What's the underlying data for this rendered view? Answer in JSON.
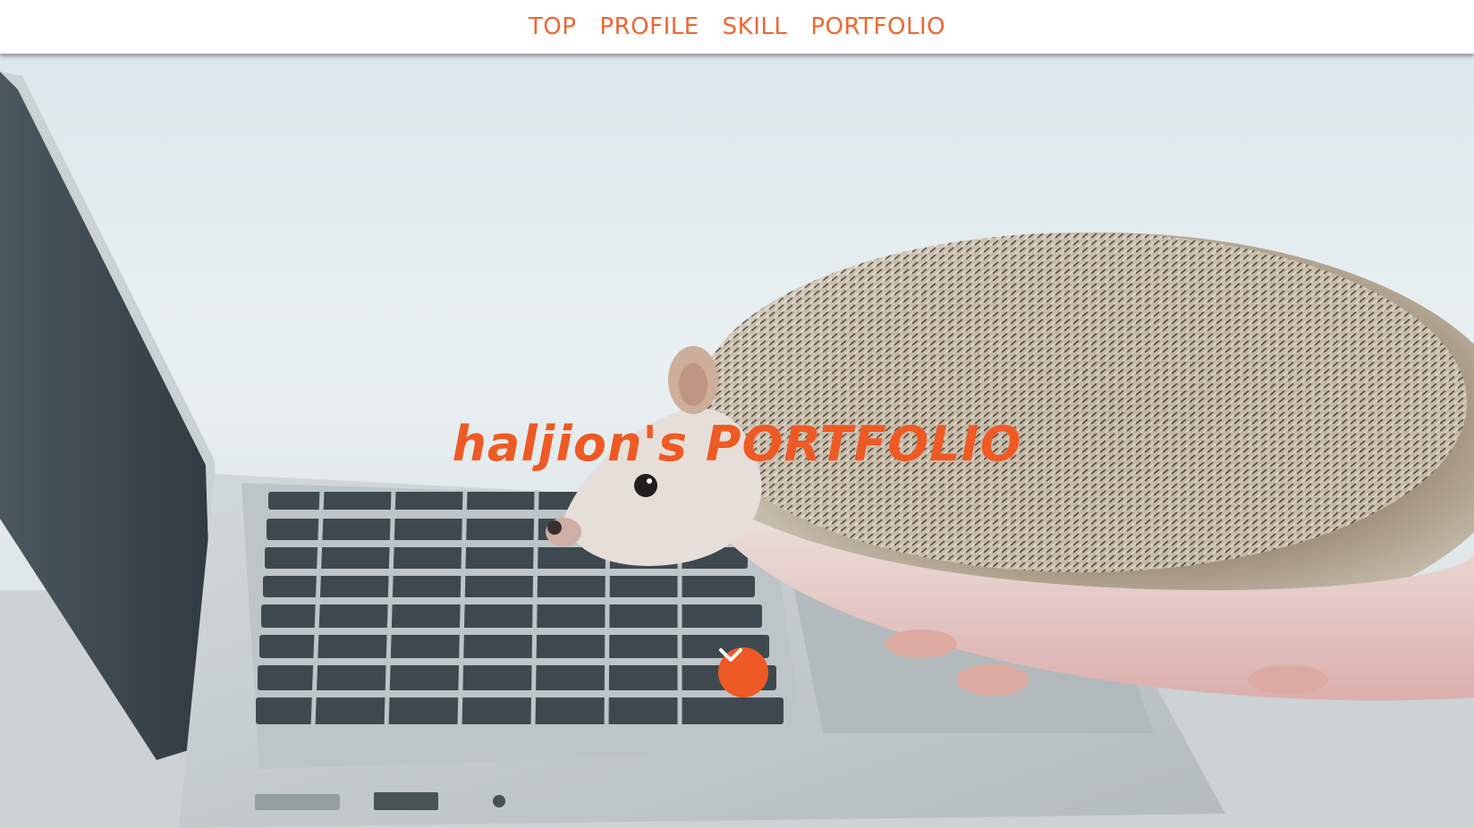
{
  "nav": {
    "items": [
      {
        "label": "TOP"
      },
      {
        "label": "PROFILE"
      },
      {
        "label": "SKILL"
      },
      {
        "label": "PORTFOLIO"
      }
    ]
  },
  "hero": {
    "title": "haljion's PORTFOLIO",
    "background_image": "hedgehog-on-laptop-photo",
    "scroll_icon": "chevron-down-icon"
  },
  "colors": {
    "accent": "#ee5a24",
    "nav_background": "#ffffff"
  }
}
